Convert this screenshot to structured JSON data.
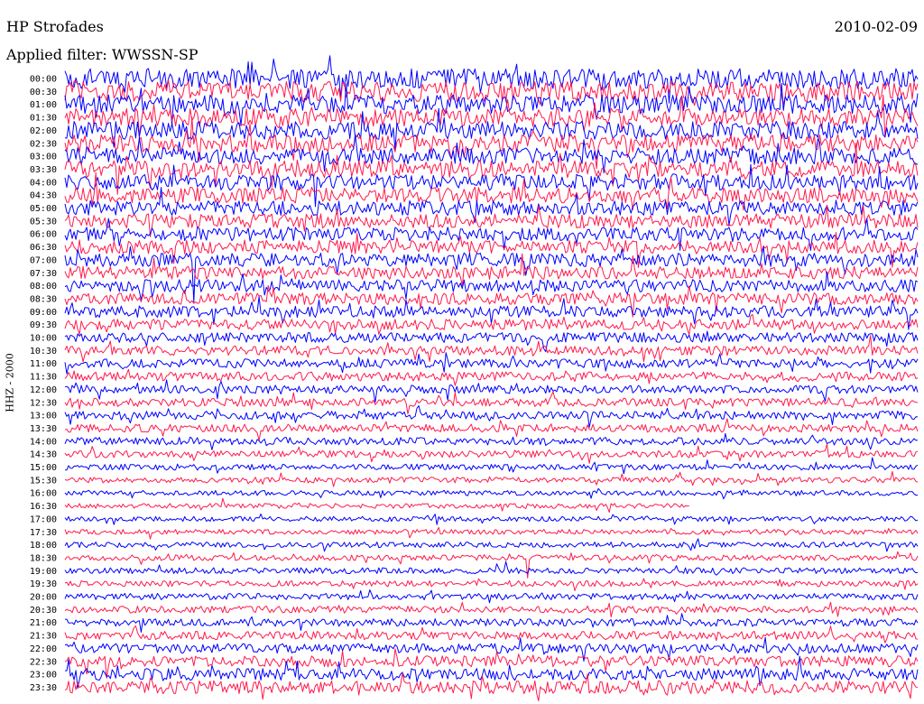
{
  "header": {
    "station": "HP Strofades",
    "date": "2010-02-09",
    "filter": "Applied filter: WWSSN-SP"
  },
  "chart_data": {
    "type": "line",
    "title": "HP Strofades",
    "ylabel": "HHZ - 2000",
    "tick_labels": [
      "00:00",
      "00:30",
      "01:00",
      "01:30",
      "02:00",
      "02:30",
      "03:00",
      "03:30",
      "04:00",
      "04:30",
      "05:00",
      "05:30",
      "06:00",
      "06:30",
      "07:00",
      "07:30",
      "08:00",
      "08:30",
      "09:00",
      "09:30",
      "10:00",
      "10:30",
      "11:00",
      "11:30",
      "12:00",
      "12:30",
      "13:00",
      "13:30",
      "14:00",
      "14:30",
      "15:00",
      "15:30",
      "16:00",
      "16:30",
      "17:00",
      "17:30",
      "18:00",
      "18:30",
      "19:00",
      "19:30",
      "20:00",
      "20:30",
      "21:00",
      "21:30",
      "22:00",
      "22:30",
      "23:00",
      "23:30"
    ],
    "trace_colors": [
      "#0000ff",
      "#ff1a4d"
    ],
    "relative_amplitude": [
      1.0,
      1.0,
      0.95,
      0.92,
      0.9,
      0.88,
      0.85,
      0.85,
      0.82,
      0.8,
      0.75,
      0.72,
      0.7,
      0.7,
      0.68,
      0.65,
      0.62,
      0.6,
      0.58,
      0.55,
      0.5,
      0.48,
      0.45,
      0.45,
      0.42,
      0.42,
      0.42,
      0.4,
      0.38,
      0.35,
      0.3,
      0.28,
      0.25,
      0.25,
      0.25,
      0.25,
      0.28,
      0.28,
      0.3,
      0.3,
      0.32,
      0.35,
      0.38,
      0.42,
      0.48,
      0.55,
      0.6,
      0.65
    ],
    "gaps": [
      {
        "row": "16:30",
        "from": "16:52",
        "to": "17:00"
      }
    ]
  }
}
